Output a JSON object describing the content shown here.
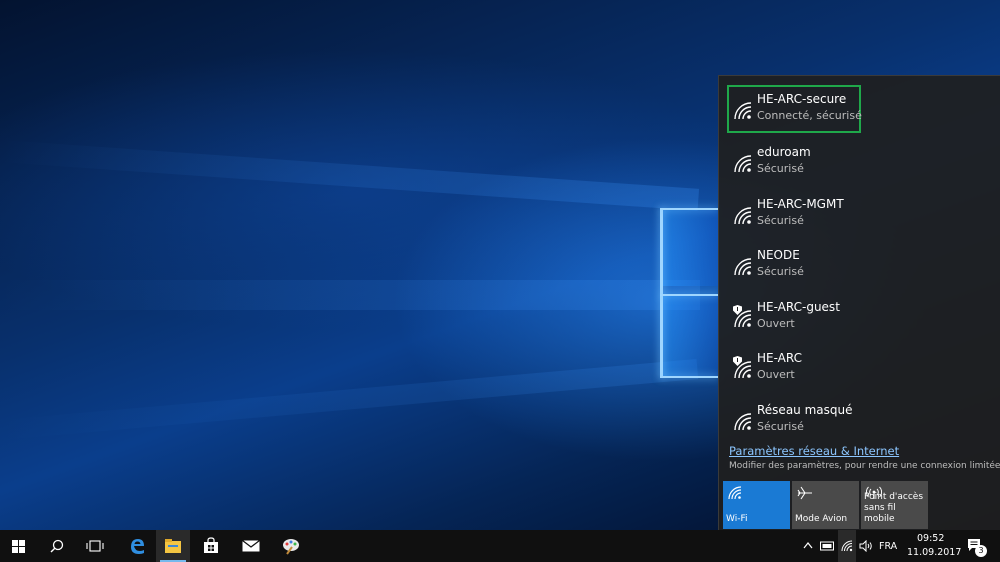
{
  "networks": [
    {
      "ssid": "HE-ARC-secure",
      "status": "Connecté, sécurisé",
      "secured": true,
      "selected": true
    },
    {
      "ssid": "eduroam",
      "status": "Sécurisé",
      "secured": true
    },
    {
      "ssid": "HE-ARC-MGMT",
      "status": "Sécurisé",
      "secured": true
    },
    {
      "ssid": "NEODE",
      "status": "Sécurisé",
      "secured": true
    },
    {
      "ssid": "HE-ARC-guest",
      "status": "Ouvert",
      "secured": false
    },
    {
      "ssid": "HE-ARC",
      "status": "Ouvert",
      "secured": false
    },
    {
      "ssid": "Réseau masqué",
      "status": "Sécurisé",
      "secured": true
    }
  ],
  "settings": {
    "link": "Paramètres réseau & Internet",
    "description": "Modifier des paramètres, pour rendre une connexion limitée."
  },
  "quick_actions": [
    {
      "label": "Wi-Fi",
      "icon": "wifi-icon",
      "active": true
    },
    {
      "label": "Mode Avion",
      "icon": "airplane-icon",
      "active": false
    },
    {
      "label": "Point d'accès sans fil mobile",
      "label_line1": "Point d'accès",
      "label_line2": "sans fil mobile",
      "icon": "hotspot-icon",
      "active": false
    }
  ],
  "taskbar": {
    "pinned": [
      "start-button",
      "search-icon",
      "task-view-icon",
      "edge-icon",
      "file-explorer-icon",
      "store-icon",
      "mail-icon",
      "paint-icon"
    ],
    "tray": {
      "language": "FRA",
      "time": "09:52",
      "date": "11.09.2017",
      "notification_count": "3"
    }
  },
  "colors": {
    "accent": "#1a7ad4",
    "selected_border": "#1fa84a",
    "link": "#8cc6ff",
    "flyout_bg": "#1f1f1f",
    "taskbar_bg": "#101010"
  }
}
